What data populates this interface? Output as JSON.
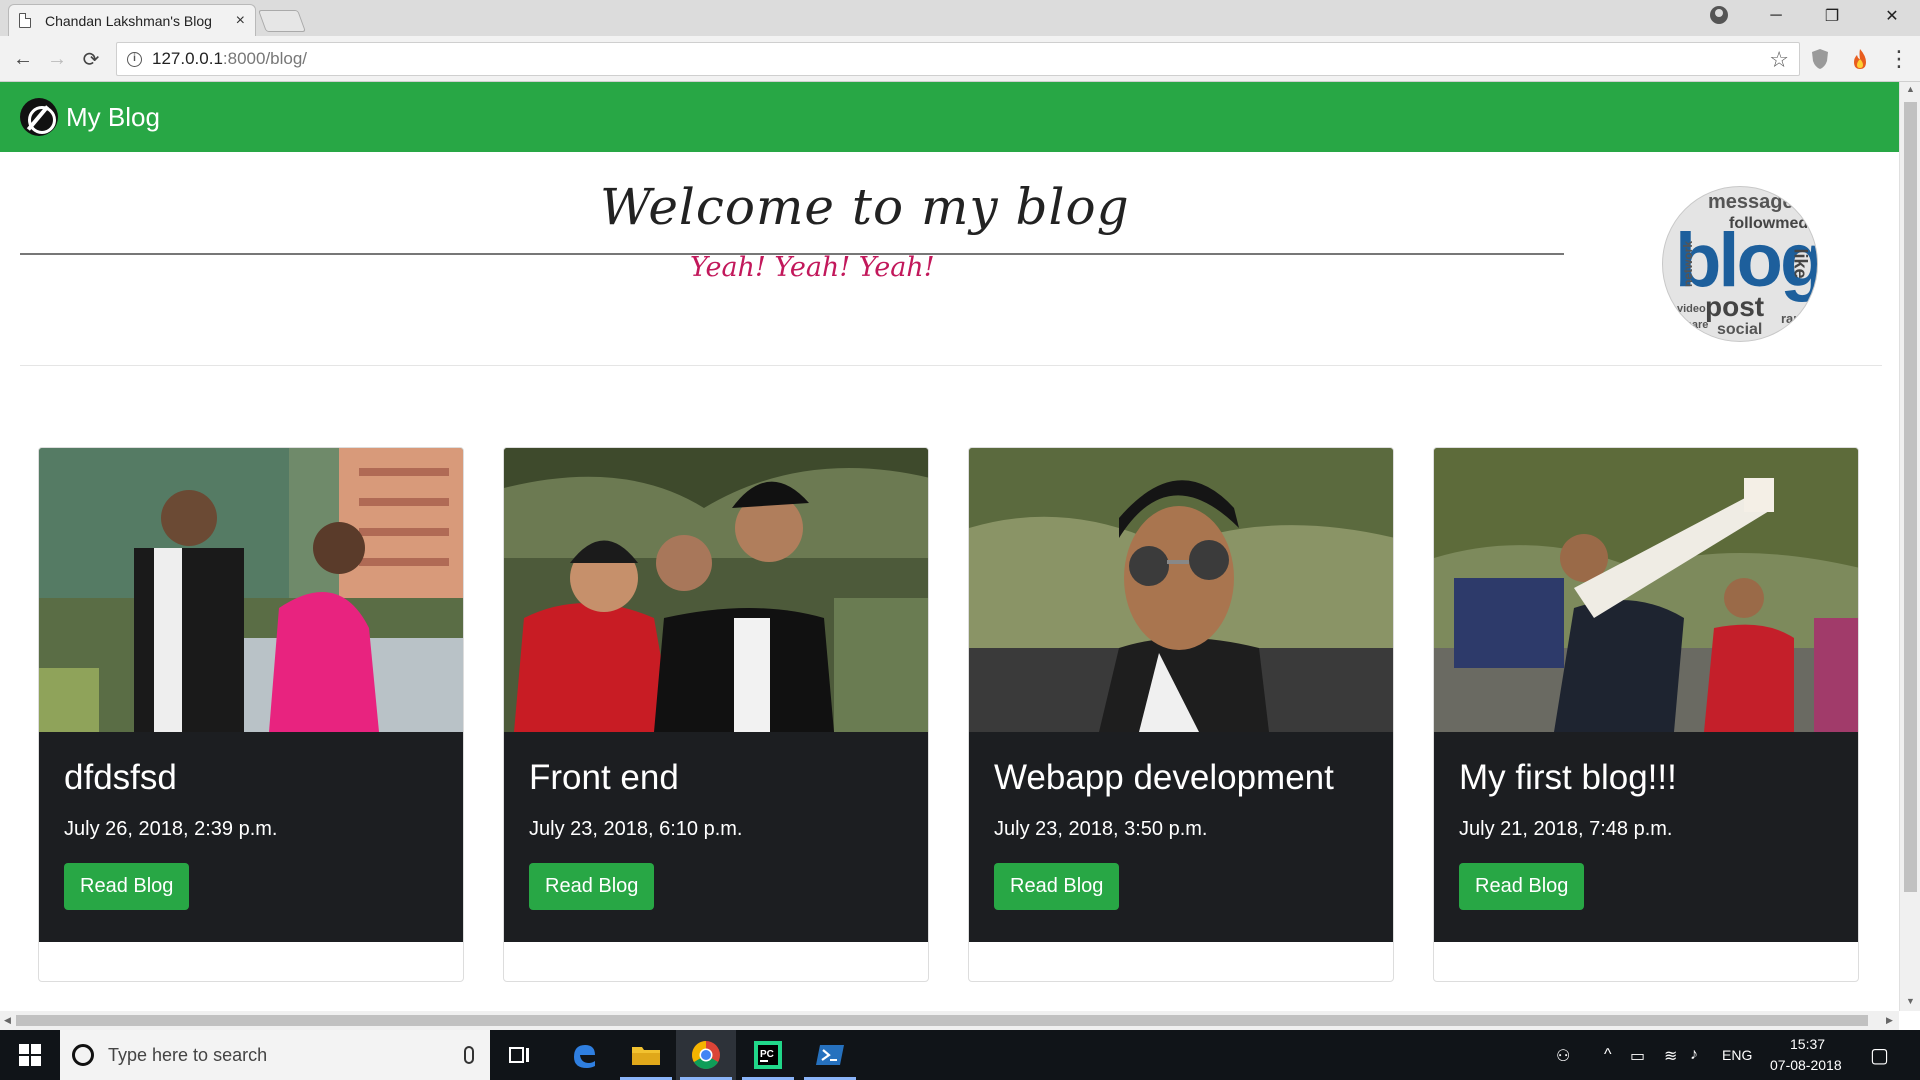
{
  "browser": {
    "tab_title": "Chandan Lakshman's Blog",
    "tab_close": "×",
    "url_host": "127.0.0.1",
    "url_rest": ":8000/blog/",
    "back": "←",
    "forward": "→",
    "reload": "⟳",
    "star": "☆",
    "minimize": "─",
    "maximize": "❐",
    "close": "✕",
    "menu": "⋮"
  },
  "site": {
    "brand": "My Blog",
    "welcome": "Welcome to my blog",
    "tagline": "Yeah! Yeah! Yeah!",
    "badge_words": [
      "message",
      "followmedia",
      "blog",
      "network",
      "post",
      "social",
      "like",
      "rank",
      "video",
      "share"
    ]
  },
  "posts": [
    {
      "title": "dfdsfsd",
      "date": "July 26, 2018, 2:39 p.m.",
      "button": "Read Blog"
    },
    {
      "title": "Front end",
      "date": "July 23, 2018, 6:10 p.m.",
      "button": "Read Blog"
    },
    {
      "title": "Webapp development",
      "date": "July 23, 2018, 3:50 p.m.",
      "button": "Read Blog"
    },
    {
      "title": "My first blog!!!",
      "date": "July 21, 2018, 7:48 p.m.",
      "button": "Read Blog"
    }
  ],
  "taskbar": {
    "search_placeholder": "Type here to search",
    "language": "ENG",
    "time": "15:37",
    "date": "07-08-2018"
  }
}
